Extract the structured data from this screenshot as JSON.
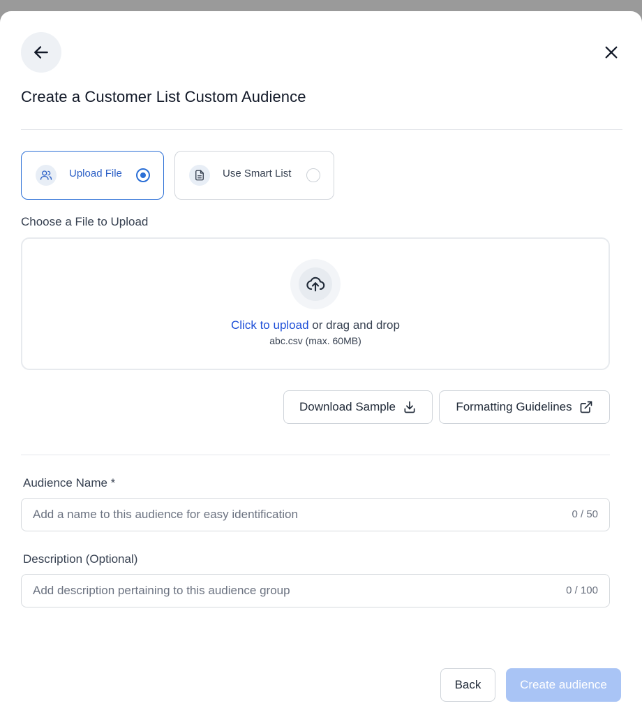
{
  "modal": {
    "title": "Create a Customer List Custom Audience"
  },
  "source_options": [
    {
      "label": "Upload File",
      "icon": "users-icon",
      "selected": true
    },
    {
      "label": "Use Smart List",
      "icon": "document-icon",
      "selected": false
    }
  ],
  "upload": {
    "section_label": "Choose a File to Upload",
    "link_text": "Click to upload",
    "drag_text": " or drag and drop",
    "hint": "abc.csv (max. 60MB)",
    "icon": "cloud-upload-icon"
  },
  "actions": {
    "download_sample": "Download Sample",
    "download_icon": "download-icon",
    "formatting_guidelines": "Formatting Guidelines",
    "external_icon": "external-link-icon"
  },
  "audience_name": {
    "label": "Audience Name *",
    "placeholder": "Add a name to this audience for easy identification",
    "value": "",
    "counter": "0 / 50"
  },
  "description": {
    "label": "Description (Optional)",
    "placeholder": "Add description pertaining to this audience group",
    "value": "",
    "counter": "0 / 100"
  },
  "footer": {
    "back_label": "Back",
    "create_label": "Create audience"
  },
  "colors": {
    "accent": "#2b6fd6",
    "link": "#1d4ed8",
    "create_disabled": "#a9c4f5",
    "overlay": "#9a9a9a"
  }
}
